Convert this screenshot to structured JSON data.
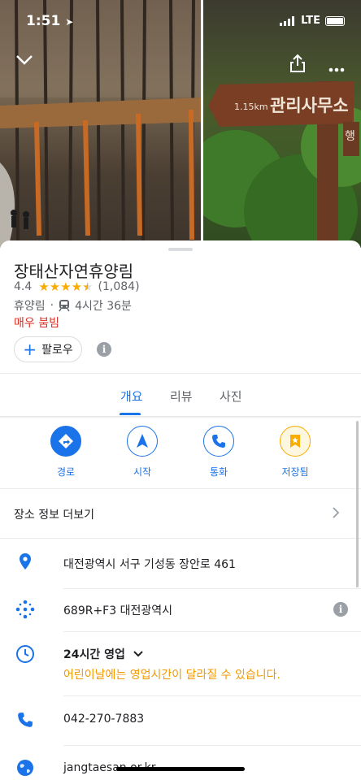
{
  "status_bar": {
    "time": "1:51",
    "network": "LTE"
  },
  "top_actions": {
    "collapse_icon": "chevron-down-icon",
    "share_icon": "share-icon",
    "more_icon": "more-icon"
  },
  "photos": {
    "sign_text_small": "1.15km",
    "sign_text_large": "관리사무소",
    "sign_side_char": "행"
  },
  "place": {
    "name": "장태산자연휴양림",
    "rating": "4.4",
    "rating_value": 4.4,
    "review_count": "(1,084)",
    "category": "휴양림",
    "separator": "·",
    "transit_time": "4시간 36분",
    "busy_status": "매우 붐빔",
    "follow_label": "팔로우"
  },
  "tabs": [
    {
      "label": "개요",
      "active": true
    },
    {
      "label": "리뷰",
      "active": false
    },
    {
      "label": "사진",
      "active": false
    }
  ],
  "actions": [
    {
      "label": "경로",
      "icon": "directions-icon"
    },
    {
      "label": "시작",
      "icon": "navigation-icon"
    },
    {
      "label": "통화",
      "icon": "phone-icon"
    },
    {
      "label": "저장됨",
      "icon": "saved-icon"
    }
  ],
  "details": {
    "more_info_label": "장소 정보 더보기",
    "address": "대전광역시 서구 기성동 장안로 461",
    "plus_code": "689R+F3 대전광역시",
    "hours_title": "24시간 영업",
    "hours_note": "어린이날에는 영업시간이 달라질 수 있습니다.",
    "phone": "042-270-7883",
    "website": "jangtaesan.or.kr"
  },
  "colors": {
    "accent": "#1a73e8",
    "star": "#f9ab00",
    "busy": "#d93025",
    "hours_note": "#f29900"
  }
}
